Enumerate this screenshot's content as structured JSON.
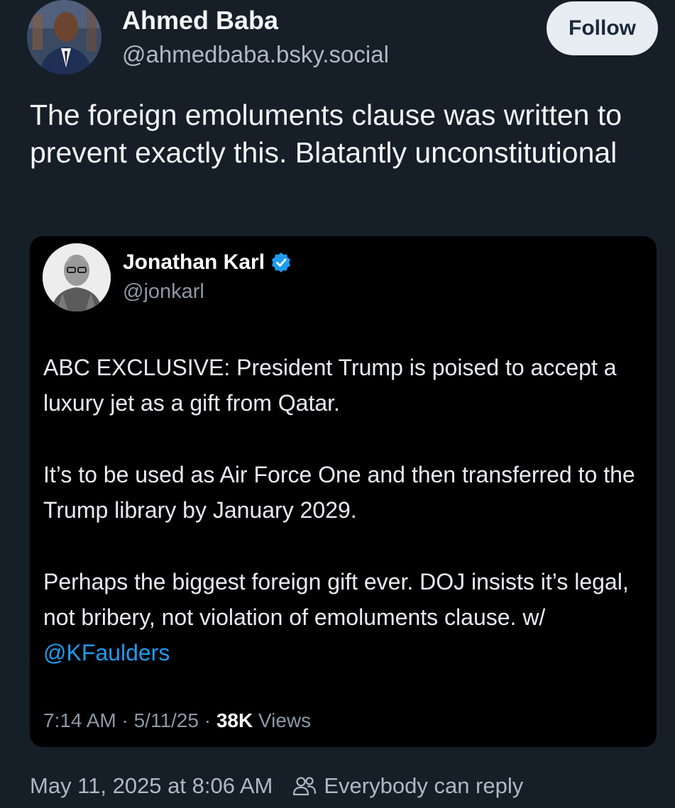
{
  "post": {
    "author_name": "Ahmed Baba",
    "author_handle": "@ahmedbaba.bsky.social",
    "follow_label": "Follow",
    "text": "The foreign emoluments clause was written to prevent exactly this. Blatantly unconstitutional"
  },
  "quote": {
    "author_name": "Jonathan Karl",
    "author_handle": "@jonkarl",
    "paragraph1": "ABC EXCLUSIVE: President Trump is poised to accept a luxury jet as a gift from Qatar.",
    "paragraph2": "It’s to be used as Air Force One and then transferred to the Trump library by January 2029.",
    "paragraph3_text": "Perhaps the biggest foreign gift ever. DOJ insists it’s legal, not bribery, not violation of emoluments clause. w/ ",
    "mention": "@KFaulders",
    "time": "7:14 AM · 5/11/25 · ",
    "views_count": "38K",
    "views_label": " Views",
    "verified_icon": "verified-badge-icon"
  },
  "footer": {
    "timestamp": "May 11, 2025 at 8:06 AM",
    "reply_setting": "Everybody can reply",
    "reply_icon": "people-icon"
  },
  "colors": {
    "background": "#161e27",
    "card_background": "#000000",
    "link": "#1d9bf0",
    "follow_button": "#e8edf2",
    "muted_text": "#aeb9c6"
  }
}
